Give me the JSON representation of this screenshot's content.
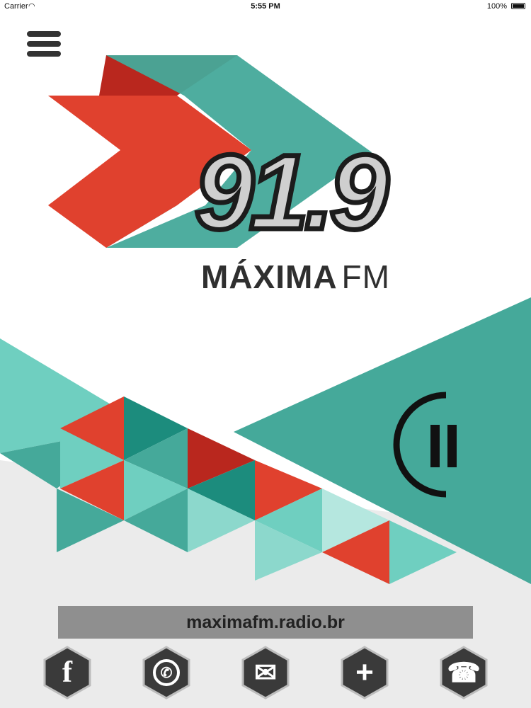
{
  "status_bar": {
    "carrier": "Carrier",
    "time": "5:55 PM",
    "battery": "100%"
  },
  "logo": {
    "frequency": "91.9",
    "name_bold": "MÁXIMA",
    "name_light": "FM"
  },
  "colors": {
    "red": "#e0412e",
    "dark_red": "#b9271e",
    "teal": "#45a99a",
    "light_teal": "#6fcfc0",
    "dark_teal": "#1c8c7d",
    "gray": "#8f8f8f"
  },
  "player": {
    "control_icon": "pause-icon"
  },
  "website": "maximafm.radio.br",
  "social": [
    {
      "icon": "facebook-icon",
      "glyph": "f"
    },
    {
      "icon": "whatsapp-icon",
      "glyph": "✆"
    },
    {
      "icon": "email-icon",
      "glyph": "✉"
    },
    {
      "icon": "tunein-icon",
      "glyph": "+"
    },
    {
      "icon": "phone-icon",
      "glyph": "☎"
    }
  ]
}
